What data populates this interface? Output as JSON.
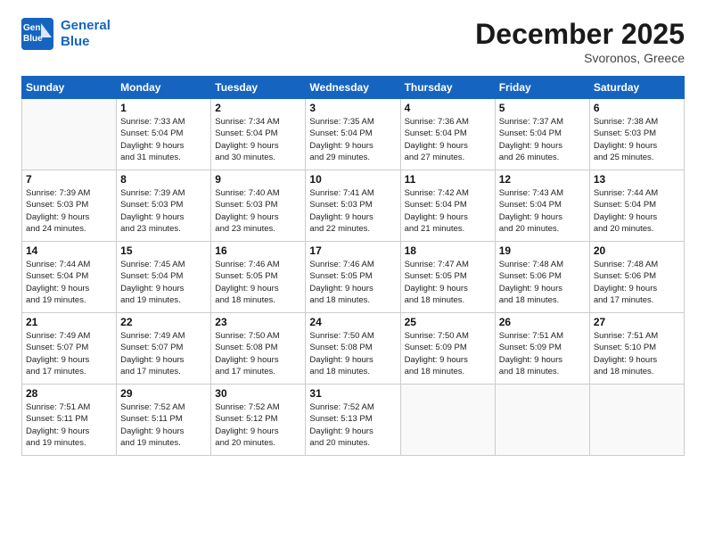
{
  "logo": {
    "line1": "General",
    "line2": "Blue"
  },
  "title": "December 2025",
  "location": "Svoronos, Greece",
  "days_of_week": [
    "Sunday",
    "Monday",
    "Tuesday",
    "Wednesday",
    "Thursday",
    "Friday",
    "Saturday"
  ],
  "weeks": [
    [
      {
        "day": "",
        "info": ""
      },
      {
        "day": "1",
        "info": "Sunrise: 7:33 AM\nSunset: 5:04 PM\nDaylight: 9 hours\nand 31 minutes."
      },
      {
        "day": "2",
        "info": "Sunrise: 7:34 AM\nSunset: 5:04 PM\nDaylight: 9 hours\nand 30 minutes."
      },
      {
        "day": "3",
        "info": "Sunrise: 7:35 AM\nSunset: 5:04 PM\nDaylight: 9 hours\nand 29 minutes."
      },
      {
        "day": "4",
        "info": "Sunrise: 7:36 AM\nSunset: 5:04 PM\nDaylight: 9 hours\nand 27 minutes."
      },
      {
        "day": "5",
        "info": "Sunrise: 7:37 AM\nSunset: 5:04 PM\nDaylight: 9 hours\nand 26 minutes."
      },
      {
        "day": "6",
        "info": "Sunrise: 7:38 AM\nSunset: 5:03 PM\nDaylight: 9 hours\nand 25 minutes."
      }
    ],
    [
      {
        "day": "7",
        "info": "Sunrise: 7:39 AM\nSunset: 5:03 PM\nDaylight: 9 hours\nand 24 minutes."
      },
      {
        "day": "8",
        "info": "Sunrise: 7:39 AM\nSunset: 5:03 PM\nDaylight: 9 hours\nand 23 minutes."
      },
      {
        "day": "9",
        "info": "Sunrise: 7:40 AM\nSunset: 5:03 PM\nDaylight: 9 hours\nand 23 minutes."
      },
      {
        "day": "10",
        "info": "Sunrise: 7:41 AM\nSunset: 5:03 PM\nDaylight: 9 hours\nand 22 minutes."
      },
      {
        "day": "11",
        "info": "Sunrise: 7:42 AM\nSunset: 5:04 PM\nDaylight: 9 hours\nand 21 minutes."
      },
      {
        "day": "12",
        "info": "Sunrise: 7:43 AM\nSunset: 5:04 PM\nDaylight: 9 hours\nand 20 minutes."
      },
      {
        "day": "13",
        "info": "Sunrise: 7:44 AM\nSunset: 5:04 PM\nDaylight: 9 hours\nand 20 minutes."
      }
    ],
    [
      {
        "day": "14",
        "info": "Sunrise: 7:44 AM\nSunset: 5:04 PM\nDaylight: 9 hours\nand 19 minutes."
      },
      {
        "day": "15",
        "info": "Sunrise: 7:45 AM\nSunset: 5:04 PM\nDaylight: 9 hours\nand 19 minutes."
      },
      {
        "day": "16",
        "info": "Sunrise: 7:46 AM\nSunset: 5:05 PM\nDaylight: 9 hours\nand 18 minutes."
      },
      {
        "day": "17",
        "info": "Sunrise: 7:46 AM\nSunset: 5:05 PM\nDaylight: 9 hours\nand 18 minutes."
      },
      {
        "day": "18",
        "info": "Sunrise: 7:47 AM\nSunset: 5:05 PM\nDaylight: 9 hours\nand 18 minutes."
      },
      {
        "day": "19",
        "info": "Sunrise: 7:48 AM\nSunset: 5:06 PM\nDaylight: 9 hours\nand 18 minutes."
      },
      {
        "day": "20",
        "info": "Sunrise: 7:48 AM\nSunset: 5:06 PM\nDaylight: 9 hours\nand 17 minutes."
      }
    ],
    [
      {
        "day": "21",
        "info": "Sunrise: 7:49 AM\nSunset: 5:07 PM\nDaylight: 9 hours\nand 17 minutes."
      },
      {
        "day": "22",
        "info": "Sunrise: 7:49 AM\nSunset: 5:07 PM\nDaylight: 9 hours\nand 17 minutes."
      },
      {
        "day": "23",
        "info": "Sunrise: 7:50 AM\nSunset: 5:08 PM\nDaylight: 9 hours\nand 17 minutes."
      },
      {
        "day": "24",
        "info": "Sunrise: 7:50 AM\nSunset: 5:08 PM\nDaylight: 9 hours\nand 18 minutes."
      },
      {
        "day": "25",
        "info": "Sunrise: 7:50 AM\nSunset: 5:09 PM\nDaylight: 9 hours\nand 18 minutes."
      },
      {
        "day": "26",
        "info": "Sunrise: 7:51 AM\nSunset: 5:09 PM\nDaylight: 9 hours\nand 18 minutes."
      },
      {
        "day": "27",
        "info": "Sunrise: 7:51 AM\nSunset: 5:10 PM\nDaylight: 9 hours\nand 18 minutes."
      }
    ],
    [
      {
        "day": "28",
        "info": "Sunrise: 7:51 AM\nSunset: 5:11 PM\nDaylight: 9 hours\nand 19 minutes."
      },
      {
        "day": "29",
        "info": "Sunrise: 7:52 AM\nSunset: 5:11 PM\nDaylight: 9 hours\nand 19 minutes."
      },
      {
        "day": "30",
        "info": "Sunrise: 7:52 AM\nSunset: 5:12 PM\nDaylight: 9 hours\nand 20 minutes."
      },
      {
        "day": "31",
        "info": "Sunrise: 7:52 AM\nSunset: 5:13 PM\nDaylight: 9 hours\nand 20 minutes."
      },
      {
        "day": "",
        "info": ""
      },
      {
        "day": "",
        "info": ""
      },
      {
        "day": "",
        "info": ""
      }
    ]
  ]
}
